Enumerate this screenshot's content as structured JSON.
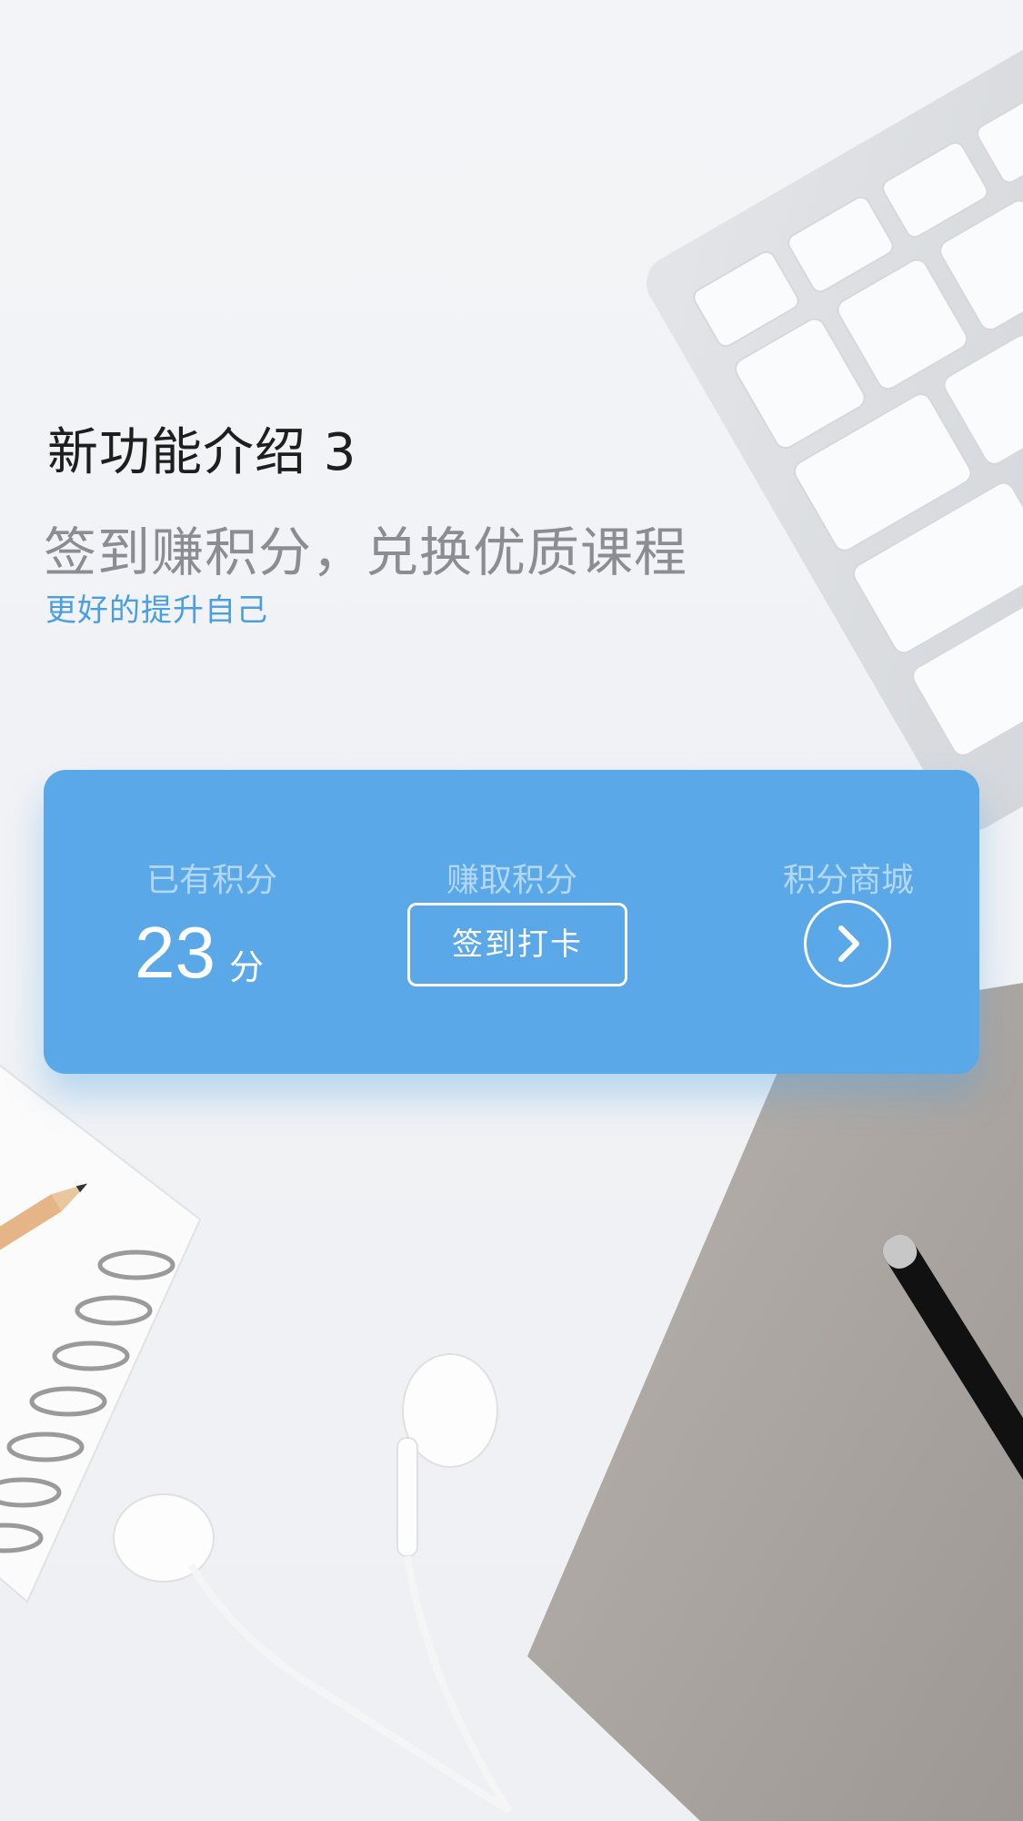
{
  "intro": {
    "title": "新功能介绍 3",
    "subtitle": "签到赚积分，兑换优质课程",
    "tagline": "更好的提升自己"
  },
  "card": {
    "points_label": "已有积分",
    "points_value": "23",
    "points_unit": "分",
    "earn_label": "赚取积分",
    "checkin_button": "签到打卡",
    "mall_label": "积分商城",
    "mall_icon": "chevron-right-icon"
  },
  "colors": {
    "accent": "#4a9fe3",
    "card_bg": "#5aa8e8",
    "label": "#b3d8f7"
  },
  "background": {
    "items": [
      "keyboard",
      "notebook",
      "pencil",
      "earphones",
      "fabric-notebook",
      "pen"
    ]
  }
}
